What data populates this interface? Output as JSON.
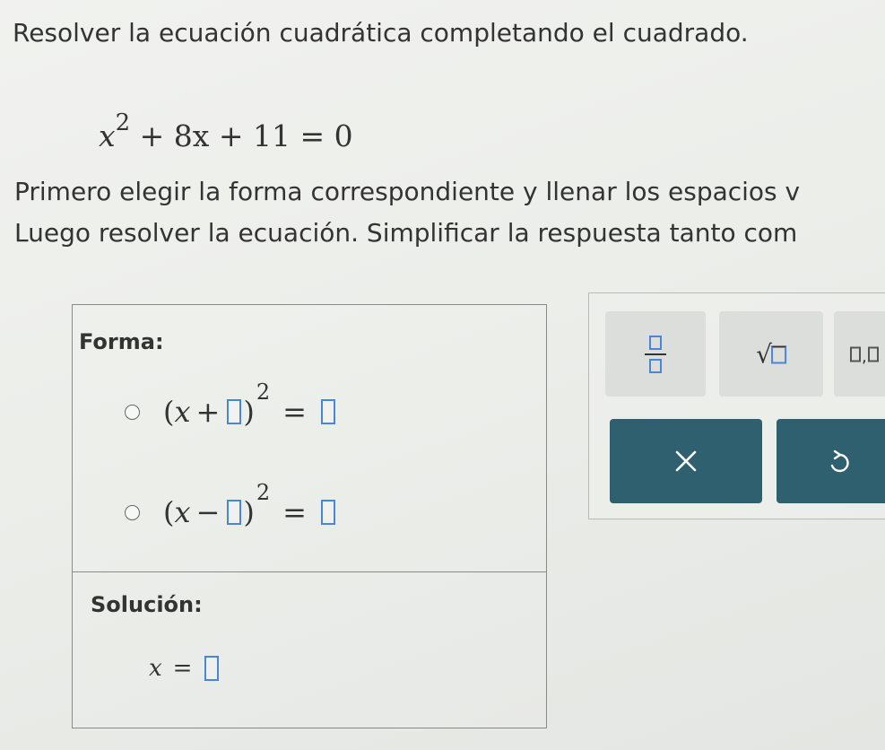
{
  "instructions": {
    "title": "Resolver la ecuación cuadrática completando el cuadrado.",
    "line1": "Primero elegir la forma correspondiente y llenar los espacios v",
    "line2": "Luego resolver la ecuación. Simplificar la respuesta tanto com"
  },
  "equation": {
    "base": "x",
    "exponent": "2",
    "rest": "+ 8x + 11 = 0"
  },
  "answer_panel": {
    "form_label": "Forma:",
    "option_plus": {
      "open": "(",
      "var": "x",
      "op": "+",
      "close": ")",
      "exponent": "2",
      "equals": "="
    },
    "option_minus": {
      "open": "(",
      "var": "x",
      "op": "−",
      "close": ")",
      "exponent": "2",
      "equals": "="
    },
    "solution_label": "Solución:",
    "solution": {
      "var": "x",
      "equals": "="
    }
  },
  "tool_palette": {
    "comma": ","
  },
  "icons": {
    "fraction": "fraction-icon",
    "sqrt": "square-root-icon",
    "comma_list": "comma-list-icon",
    "clear": "close-icon",
    "undo": "undo-icon"
  },
  "colors": {
    "input_border": "#4a86d6",
    "action_button": "#2f6070"
  }
}
